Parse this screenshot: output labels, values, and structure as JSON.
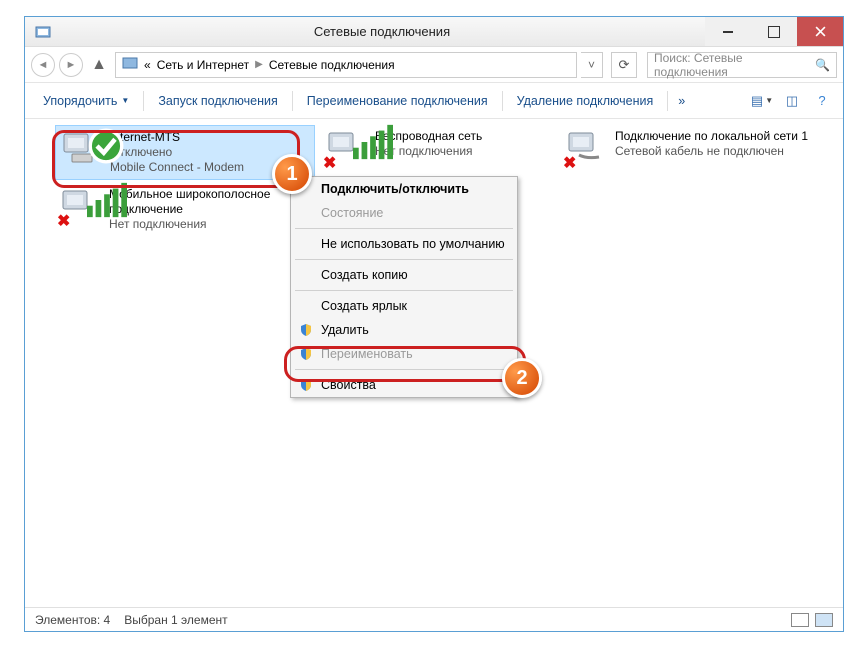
{
  "window": {
    "title": "Сетевые подключения"
  },
  "breadcrumb": {
    "prefix": "«",
    "seg1": "Сеть и Интернет",
    "seg2": "Сетевые подключения"
  },
  "search": {
    "placeholder": "Поиск: Сетевые подключения"
  },
  "toolbar": {
    "organize": "Упорядочить",
    "start": "Запуск подключения",
    "rename": "Переименование подключения",
    "delete": "Удаление подключения",
    "more": "»"
  },
  "connections": [
    {
      "name": "Internet-MTS",
      "status": "Отключено",
      "detail": "Mobile Connect - Modem"
    },
    {
      "name": "Беспроводная сеть",
      "status": "Нет подключения",
      "detail": ""
    },
    {
      "name": "Подключение по локальной сети 1",
      "status": "Сетевой кабель не подключен",
      "detail": ""
    },
    {
      "name": "Мобильное широкополосное подключение",
      "status": "Нет подключения",
      "detail": ""
    }
  ],
  "context_menu": {
    "items": [
      {
        "label": "Подключить/отключить",
        "bold": true,
        "enabled": true
      },
      {
        "label": "Состояние",
        "enabled": false,
        "sep_after": true
      },
      {
        "label": "Не использовать по умолчанию",
        "enabled": true,
        "sep_after": true
      },
      {
        "label": "Создать копию",
        "enabled": true,
        "sep_after": true
      },
      {
        "label": "Создать ярлык",
        "enabled": true
      },
      {
        "label": "Удалить",
        "enabled": true,
        "shield": true
      },
      {
        "label": "Переименовать",
        "enabled": false,
        "shield": true,
        "sep_after": true
      },
      {
        "label": "Свойства",
        "enabled": true,
        "shield": true
      }
    ]
  },
  "statusbar": {
    "count_label": "Элементов: 4",
    "selected_label": "Выбран 1 элемент"
  },
  "callouts": {
    "one": "1",
    "two": "2"
  }
}
